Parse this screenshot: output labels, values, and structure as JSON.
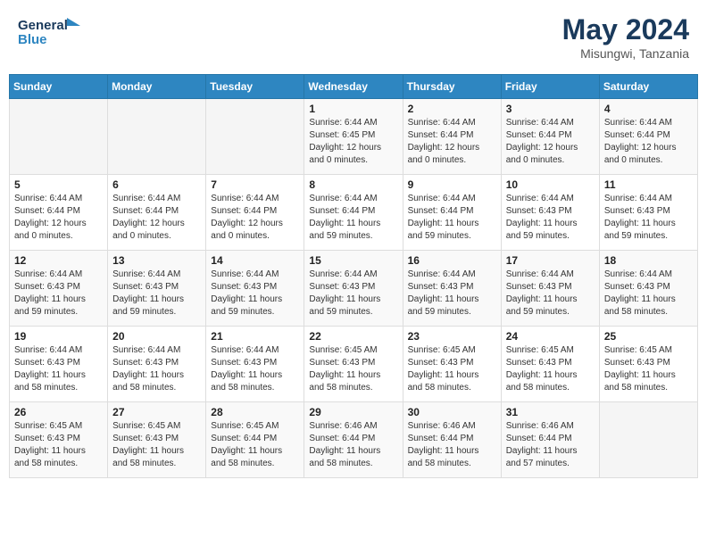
{
  "logo": {
    "line1": "General",
    "line2": "Blue"
  },
  "title": "May 2024",
  "location": "Misungwi, Tanzania",
  "days_header": [
    "Sunday",
    "Monday",
    "Tuesday",
    "Wednesday",
    "Thursday",
    "Friday",
    "Saturday"
  ],
  "weeks": [
    [
      {
        "day": "",
        "info": ""
      },
      {
        "day": "",
        "info": ""
      },
      {
        "day": "",
        "info": ""
      },
      {
        "day": "1",
        "info": "Sunrise: 6:44 AM\nSunset: 6:45 PM\nDaylight: 12 hours\nand 0 minutes."
      },
      {
        "day": "2",
        "info": "Sunrise: 6:44 AM\nSunset: 6:44 PM\nDaylight: 12 hours\nand 0 minutes."
      },
      {
        "day": "3",
        "info": "Sunrise: 6:44 AM\nSunset: 6:44 PM\nDaylight: 12 hours\nand 0 minutes."
      },
      {
        "day": "4",
        "info": "Sunrise: 6:44 AM\nSunset: 6:44 PM\nDaylight: 12 hours\nand 0 minutes."
      }
    ],
    [
      {
        "day": "5",
        "info": "Sunrise: 6:44 AM\nSunset: 6:44 PM\nDaylight: 12 hours\nand 0 minutes."
      },
      {
        "day": "6",
        "info": "Sunrise: 6:44 AM\nSunset: 6:44 PM\nDaylight: 12 hours\nand 0 minutes."
      },
      {
        "day": "7",
        "info": "Sunrise: 6:44 AM\nSunset: 6:44 PM\nDaylight: 12 hours\nand 0 minutes."
      },
      {
        "day": "8",
        "info": "Sunrise: 6:44 AM\nSunset: 6:44 PM\nDaylight: 11 hours\nand 59 minutes."
      },
      {
        "day": "9",
        "info": "Sunrise: 6:44 AM\nSunset: 6:44 PM\nDaylight: 11 hours\nand 59 minutes."
      },
      {
        "day": "10",
        "info": "Sunrise: 6:44 AM\nSunset: 6:43 PM\nDaylight: 11 hours\nand 59 minutes."
      },
      {
        "day": "11",
        "info": "Sunrise: 6:44 AM\nSunset: 6:43 PM\nDaylight: 11 hours\nand 59 minutes."
      }
    ],
    [
      {
        "day": "12",
        "info": "Sunrise: 6:44 AM\nSunset: 6:43 PM\nDaylight: 11 hours\nand 59 minutes."
      },
      {
        "day": "13",
        "info": "Sunrise: 6:44 AM\nSunset: 6:43 PM\nDaylight: 11 hours\nand 59 minutes."
      },
      {
        "day": "14",
        "info": "Sunrise: 6:44 AM\nSunset: 6:43 PM\nDaylight: 11 hours\nand 59 minutes."
      },
      {
        "day": "15",
        "info": "Sunrise: 6:44 AM\nSunset: 6:43 PM\nDaylight: 11 hours\nand 59 minutes."
      },
      {
        "day": "16",
        "info": "Sunrise: 6:44 AM\nSunset: 6:43 PM\nDaylight: 11 hours\nand 59 minutes."
      },
      {
        "day": "17",
        "info": "Sunrise: 6:44 AM\nSunset: 6:43 PM\nDaylight: 11 hours\nand 59 minutes."
      },
      {
        "day": "18",
        "info": "Sunrise: 6:44 AM\nSunset: 6:43 PM\nDaylight: 11 hours\nand 58 minutes."
      }
    ],
    [
      {
        "day": "19",
        "info": "Sunrise: 6:44 AM\nSunset: 6:43 PM\nDaylight: 11 hours\nand 58 minutes."
      },
      {
        "day": "20",
        "info": "Sunrise: 6:44 AM\nSunset: 6:43 PM\nDaylight: 11 hours\nand 58 minutes."
      },
      {
        "day": "21",
        "info": "Sunrise: 6:44 AM\nSunset: 6:43 PM\nDaylight: 11 hours\nand 58 minutes."
      },
      {
        "day": "22",
        "info": "Sunrise: 6:45 AM\nSunset: 6:43 PM\nDaylight: 11 hours\nand 58 minutes."
      },
      {
        "day": "23",
        "info": "Sunrise: 6:45 AM\nSunset: 6:43 PM\nDaylight: 11 hours\nand 58 minutes."
      },
      {
        "day": "24",
        "info": "Sunrise: 6:45 AM\nSunset: 6:43 PM\nDaylight: 11 hours\nand 58 minutes."
      },
      {
        "day": "25",
        "info": "Sunrise: 6:45 AM\nSunset: 6:43 PM\nDaylight: 11 hours\nand 58 minutes."
      }
    ],
    [
      {
        "day": "26",
        "info": "Sunrise: 6:45 AM\nSunset: 6:43 PM\nDaylight: 11 hours\nand 58 minutes."
      },
      {
        "day": "27",
        "info": "Sunrise: 6:45 AM\nSunset: 6:43 PM\nDaylight: 11 hours\nand 58 minutes."
      },
      {
        "day": "28",
        "info": "Sunrise: 6:45 AM\nSunset: 6:44 PM\nDaylight: 11 hours\nand 58 minutes."
      },
      {
        "day": "29",
        "info": "Sunrise: 6:46 AM\nSunset: 6:44 PM\nDaylight: 11 hours\nand 58 minutes."
      },
      {
        "day": "30",
        "info": "Sunrise: 6:46 AM\nSunset: 6:44 PM\nDaylight: 11 hours\nand 58 minutes."
      },
      {
        "day": "31",
        "info": "Sunrise: 6:46 AM\nSunset: 6:44 PM\nDaylight: 11 hours\nand 57 minutes."
      },
      {
        "day": "",
        "info": ""
      }
    ]
  ]
}
